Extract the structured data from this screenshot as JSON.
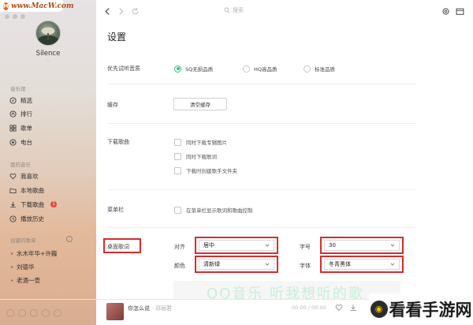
{
  "watermark": {
    "site": "www.MacW.com",
    "corner_text": "看看手游网"
  },
  "user": {
    "name": "Silence"
  },
  "sidebar": {
    "music_hall": {
      "title": "音乐馆",
      "items": [
        {
          "label": "精选",
          "icon": "compass-icon"
        },
        {
          "label": "排行",
          "icon": "ranking-icon"
        },
        {
          "label": "歌单",
          "icon": "grid-icon"
        },
        {
          "label": "电台",
          "icon": "radio-icon"
        }
      ]
    },
    "my_music": {
      "title": "我的音乐",
      "items": [
        {
          "label": "我喜欢",
          "icon": "heart-icon"
        },
        {
          "label": "本地歌曲",
          "icon": "folder-icon"
        },
        {
          "label": "下载歌曲",
          "icon": "download-icon",
          "badge": "1"
        },
        {
          "label": "播放历史",
          "icon": "clock-icon"
        }
      ]
    },
    "playlists": {
      "title": "创建的歌单",
      "items": [
        {
          "label": "水木年华+许巍"
        },
        {
          "label": "刘德华"
        },
        {
          "label": "老酒一壶"
        }
      ]
    }
  },
  "topbar": {
    "search_placeholder": "搜索"
  },
  "settings": {
    "title": "设置",
    "quality": {
      "label": "优先试听音质",
      "options": [
        "SQ无损品质",
        "HQ高品质",
        "标准品质"
      ],
      "selected": "SQ无损品质"
    },
    "cache": {
      "label": "缓存",
      "button": "清空缓存"
    },
    "download": {
      "label": "下载歌曲",
      "options": [
        "同时下载专辑图片",
        "同时下载歌词",
        "下载时创建歌手文件夹"
      ]
    },
    "menubar": {
      "label": "菜单栏",
      "option": "在菜单栏显示歌词和歌曲控制"
    },
    "desktop_lyrics": {
      "label": "桌面歌词",
      "align_label": "对齐",
      "align_value": "居中",
      "font_size_label": "字号",
      "font_size_value": "30",
      "color_label": "颜色",
      "color_value": "清新绿",
      "font_label": "字体",
      "font_value": "冬青黑体",
      "preview_text": "QQ音乐 听我想听的歌"
    }
  },
  "player": {
    "song": "你怎么说",
    "artist": " - 邓丽君",
    "time": "00:00 / 00:00"
  },
  "colors": {
    "accent": "#31c27c",
    "highlight": "#d82b2b"
  }
}
